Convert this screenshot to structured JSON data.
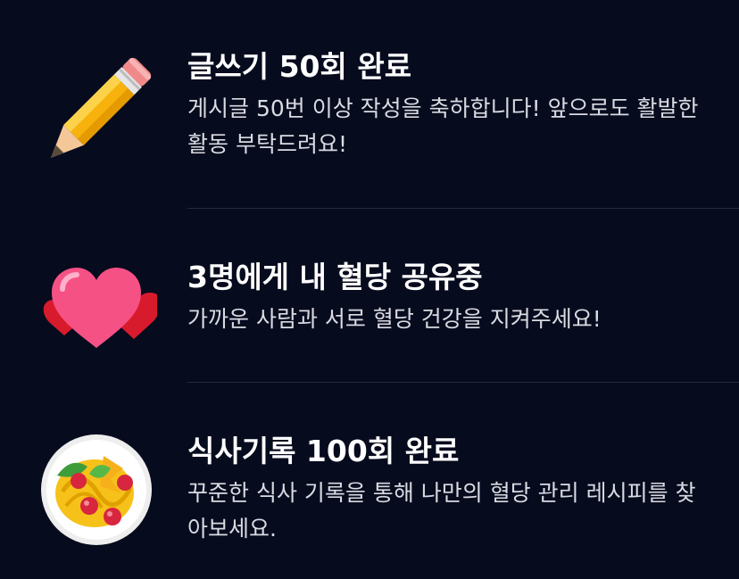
{
  "achievements": [
    {
      "icon": "pencil-icon",
      "title": "글쓰기 50회 완료",
      "description": "게시글 50번 이상 작성을 축하합니다! 앞으로도 활발한 활동 부탁드려요!"
    },
    {
      "icon": "hearts-icon",
      "title": "3명에게 내 혈당 공유중",
      "description": "가까운 사람과 서로 혈당 건강을 지켜주세요!"
    },
    {
      "icon": "pasta-plate-icon",
      "title": "식사기록 100회 완료",
      "description": "꾸준한 식사 기록을 통해 나만의 혈당 관리 레시피를 찾아보세요."
    }
  ],
  "colors": {
    "background": "#070b1e",
    "divider": "#252a3c",
    "title": "#ffffff",
    "description": "#d9dbe2"
  }
}
